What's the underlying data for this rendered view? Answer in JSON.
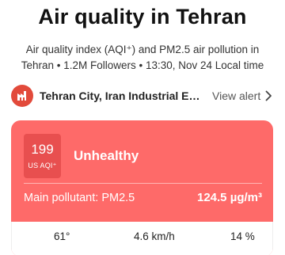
{
  "header": {
    "title": "Air quality in Tehran",
    "subtitle": "Air quality index (AQI⁺) and PM2.5 air pollution in Tehran • 1.2M Followers • 13:30, Nov 24 Local time"
  },
  "alert": {
    "station_name": "Tehran City, Iran Industrial Emissi...",
    "view_alert_label": "View alert",
    "logo_icon": "factory-icon",
    "chevron_icon": "chevron-right-icon"
  },
  "card": {
    "aqi_value": "199",
    "aqi_unit": "US AQI⁺",
    "status": "Unhealthy",
    "main_pollutant_label": "Main pollutant: PM2.5",
    "concentration": "124.5 µg/m³",
    "colors": {
      "card": "#fe6a69",
      "aqi_box": "#e84f4f",
      "logo": "#e24a3b"
    }
  },
  "weather": {
    "temperature": "61°",
    "wind": "4.6 km/h",
    "humidity": "14 %"
  }
}
